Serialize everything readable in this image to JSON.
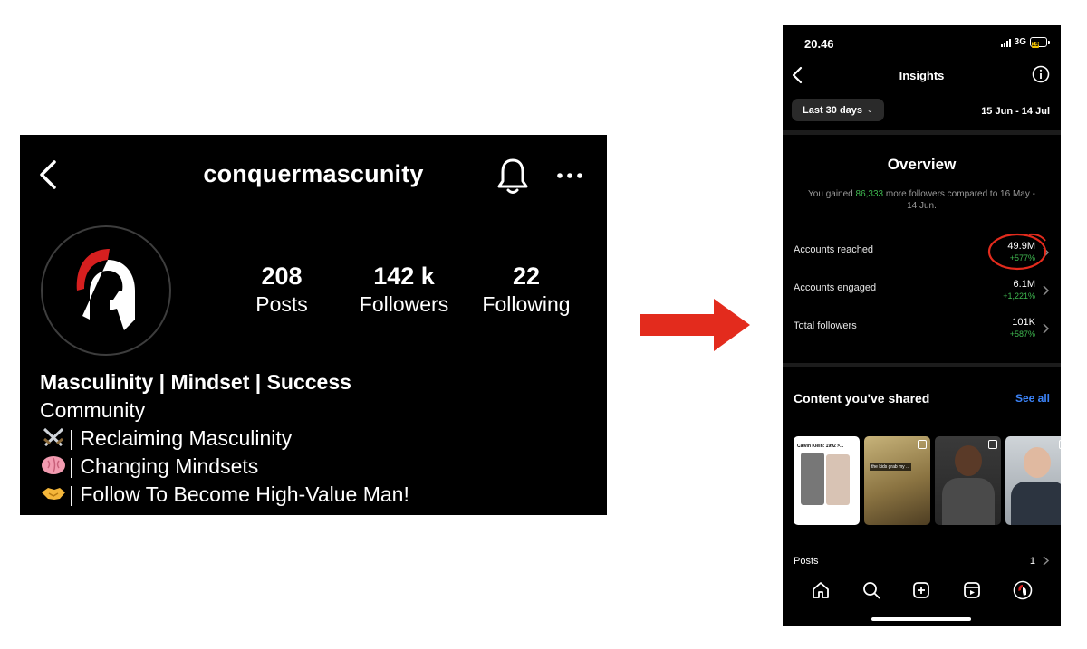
{
  "profile": {
    "username": "conquermascunity",
    "stats": [
      {
        "value": "208",
        "label": "Posts"
      },
      {
        "value": "142 k",
        "label": "Followers"
      },
      {
        "value": "22",
        "label": "Following"
      }
    ],
    "bio": {
      "name": "Masculinity | Mindset | Success",
      "category": "Community",
      "lines": [
        {
          "emoji": "crossed-swords-icon",
          "text": "| Reclaiming Masculinity"
        },
        {
          "emoji": "brain-icon",
          "text": "| Changing Mindsets"
        },
        {
          "emoji": "handshake-icon",
          "text": "| Follow To Become High-Value Man!"
        }
      ]
    },
    "icons": [
      "back-arrow-icon",
      "bell-icon",
      "more-icon"
    ]
  },
  "arrow": {
    "color": "#e32b1d",
    "icon": "arrow-right-icon"
  },
  "phone": {
    "status": {
      "time": "20.46",
      "network": "3G",
      "battery": "19"
    },
    "nav": {
      "title": "Insights"
    },
    "filter": {
      "label": "Last 30 days",
      "date_range": "15 Jun - 14 Jul"
    },
    "overview": {
      "title": "Overview",
      "sub_prefix": "You gained ",
      "sub_highlight": "86,333",
      "sub_suffix": " more followers compared to 16 May - 14 Jun."
    },
    "metrics": [
      {
        "label": "Accounts reached",
        "value": "49.9M",
        "change": "+577%"
      },
      {
        "label": "Accounts engaged",
        "value": "6.1M",
        "change": "+1,221%"
      },
      {
        "label": "Total followers",
        "value": "101K",
        "change": "+587%"
      }
    ],
    "content": {
      "title": "Content you've shared",
      "see_all": "See all",
      "thumb1_caption": "Calvin Klein: 1992 >...",
      "thumb2_chip": "the kids grab my ..."
    },
    "posts_row": {
      "label": "Posts",
      "value": "1"
    },
    "tabs": [
      "home-icon",
      "search-icon",
      "create-icon",
      "reels-icon",
      "profile-avatar-icon"
    ],
    "colors": {
      "positive": "#3fb950",
      "link": "#3b82f6",
      "highlight_circle": "#e32b1d"
    }
  }
}
